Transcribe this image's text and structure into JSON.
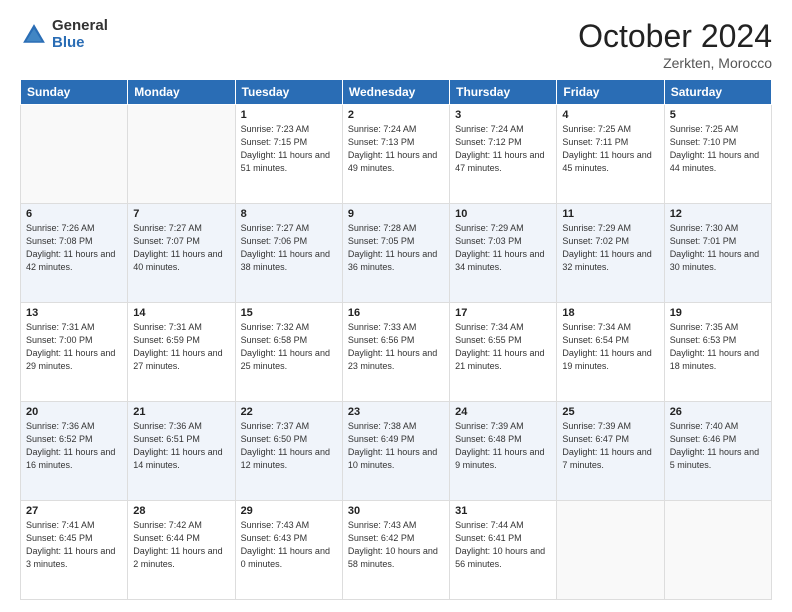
{
  "logo": {
    "general": "General",
    "blue": "Blue"
  },
  "title": "October 2024",
  "location": "Zerkten, Morocco",
  "days_header": [
    "Sunday",
    "Monday",
    "Tuesday",
    "Wednesday",
    "Thursday",
    "Friday",
    "Saturday"
  ],
  "weeks": [
    [
      {
        "day": "",
        "info": ""
      },
      {
        "day": "",
        "info": ""
      },
      {
        "day": "1",
        "info": "Sunrise: 7:23 AM\nSunset: 7:15 PM\nDaylight: 11 hours and 51 minutes."
      },
      {
        "day": "2",
        "info": "Sunrise: 7:24 AM\nSunset: 7:13 PM\nDaylight: 11 hours and 49 minutes."
      },
      {
        "day": "3",
        "info": "Sunrise: 7:24 AM\nSunset: 7:12 PM\nDaylight: 11 hours and 47 minutes."
      },
      {
        "day": "4",
        "info": "Sunrise: 7:25 AM\nSunset: 7:11 PM\nDaylight: 11 hours and 45 minutes."
      },
      {
        "day": "5",
        "info": "Sunrise: 7:25 AM\nSunset: 7:10 PM\nDaylight: 11 hours and 44 minutes."
      }
    ],
    [
      {
        "day": "6",
        "info": "Sunrise: 7:26 AM\nSunset: 7:08 PM\nDaylight: 11 hours and 42 minutes."
      },
      {
        "day": "7",
        "info": "Sunrise: 7:27 AM\nSunset: 7:07 PM\nDaylight: 11 hours and 40 minutes."
      },
      {
        "day": "8",
        "info": "Sunrise: 7:27 AM\nSunset: 7:06 PM\nDaylight: 11 hours and 38 minutes."
      },
      {
        "day": "9",
        "info": "Sunrise: 7:28 AM\nSunset: 7:05 PM\nDaylight: 11 hours and 36 minutes."
      },
      {
        "day": "10",
        "info": "Sunrise: 7:29 AM\nSunset: 7:03 PM\nDaylight: 11 hours and 34 minutes."
      },
      {
        "day": "11",
        "info": "Sunrise: 7:29 AM\nSunset: 7:02 PM\nDaylight: 11 hours and 32 minutes."
      },
      {
        "day": "12",
        "info": "Sunrise: 7:30 AM\nSunset: 7:01 PM\nDaylight: 11 hours and 30 minutes."
      }
    ],
    [
      {
        "day": "13",
        "info": "Sunrise: 7:31 AM\nSunset: 7:00 PM\nDaylight: 11 hours and 29 minutes."
      },
      {
        "day": "14",
        "info": "Sunrise: 7:31 AM\nSunset: 6:59 PM\nDaylight: 11 hours and 27 minutes."
      },
      {
        "day": "15",
        "info": "Sunrise: 7:32 AM\nSunset: 6:58 PM\nDaylight: 11 hours and 25 minutes."
      },
      {
        "day": "16",
        "info": "Sunrise: 7:33 AM\nSunset: 6:56 PM\nDaylight: 11 hours and 23 minutes."
      },
      {
        "day": "17",
        "info": "Sunrise: 7:34 AM\nSunset: 6:55 PM\nDaylight: 11 hours and 21 minutes."
      },
      {
        "day": "18",
        "info": "Sunrise: 7:34 AM\nSunset: 6:54 PM\nDaylight: 11 hours and 19 minutes."
      },
      {
        "day": "19",
        "info": "Sunrise: 7:35 AM\nSunset: 6:53 PM\nDaylight: 11 hours and 18 minutes."
      }
    ],
    [
      {
        "day": "20",
        "info": "Sunrise: 7:36 AM\nSunset: 6:52 PM\nDaylight: 11 hours and 16 minutes."
      },
      {
        "day": "21",
        "info": "Sunrise: 7:36 AM\nSunset: 6:51 PM\nDaylight: 11 hours and 14 minutes."
      },
      {
        "day": "22",
        "info": "Sunrise: 7:37 AM\nSunset: 6:50 PM\nDaylight: 11 hours and 12 minutes."
      },
      {
        "day": "23",
        "info": "Sunrise: 7:38 AM\nSunset: 6:49 PM\nDaylight: 11 hours and 10 minutes."
      },
      {
        "day": "24",
        "info": "Sunrise: 7:39 AM\nSunset: 6:48 PM\nDaylight: 11 hours and 9 minutes."
      },
      {
        "day": "25",
        "info": "Sunrise: 7:39 AM\nSunset: 6:47 PM\nDaylight: 11 hours and 7 minutes."
      },
      {
        "day": "26",
        "info": "Sunrise: 7:40 AM\nSunset: 6:46 PM\nDaylight: 11 hours and 5 minutes."
      }
    ],
    [
      {
        "day": "27",
        "info": "Sunrise: 7:41 AM\nSunset: 6:45 PM\nDaylight: 11 hours and 3 minutes."
      },
      {
        "day": "28",
        "info": "Sunrise: 7:42 AM\nSunset: 6:44 PM\nDaylight: 11 hours and 2 minutes."
      },
      {
        "day": "29",
        "info": "Sunrise: 7:43 AM\nSunset: 6:43 PM\nDaylight: 11 hours and 0 minutes."
      },
      {
        "day": "30",
        "info": "Sunrise: 7:43 AM\nSunset: 6:42 PM\nDaylight: 10 hours and 58 minutes."
      },
      {
        "day": "31",
        "info": "Sunrise: 7:44 AM\nSunset: 6:41 PM\nDaylight: 10 hours and 56 minutes."
      },
      {
        "day": "",
        "info": ""
      },
      {
        "day": "",
        "info": ""
      }
    ]
  ]
}
